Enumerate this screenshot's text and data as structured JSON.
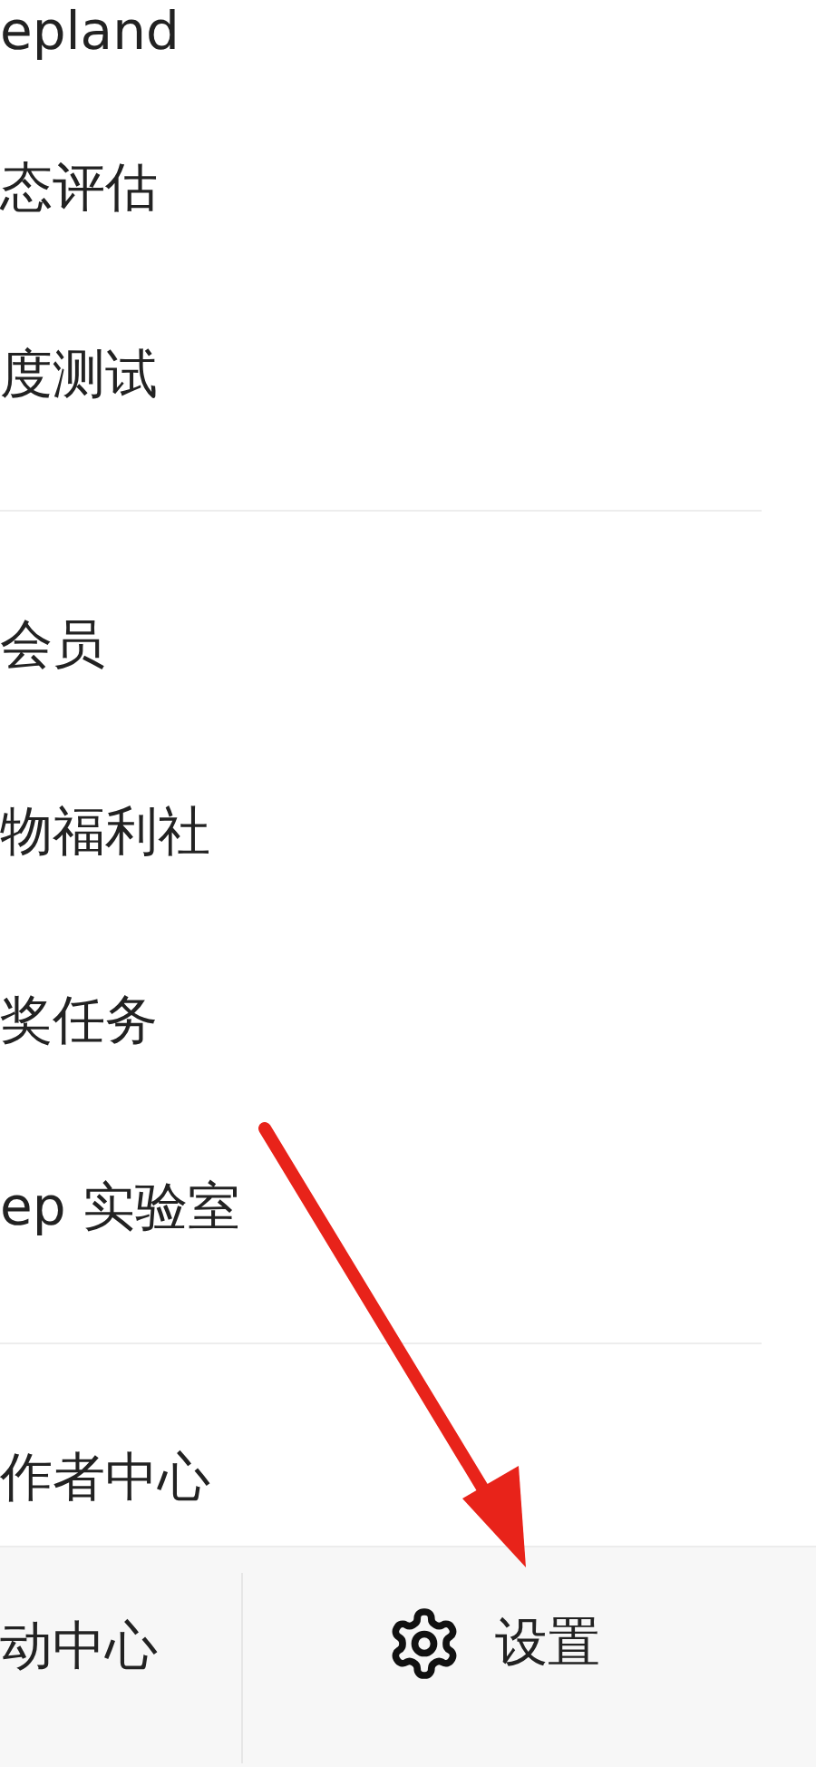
{
  "sections": [
    {
      "items": [
        "epland",
        "态评估",
        "度测试"
      ]
    },
    {
      "items": [
        "会员",
        "物福利社",
        "奖任务",
        "ep 实验室"
      ]
    },
    {
      "items": [
        "作者中心"
      ]
    }
  ],
  "footer": {
    "left": "动中心",
    "right": "设置"
  }
}
